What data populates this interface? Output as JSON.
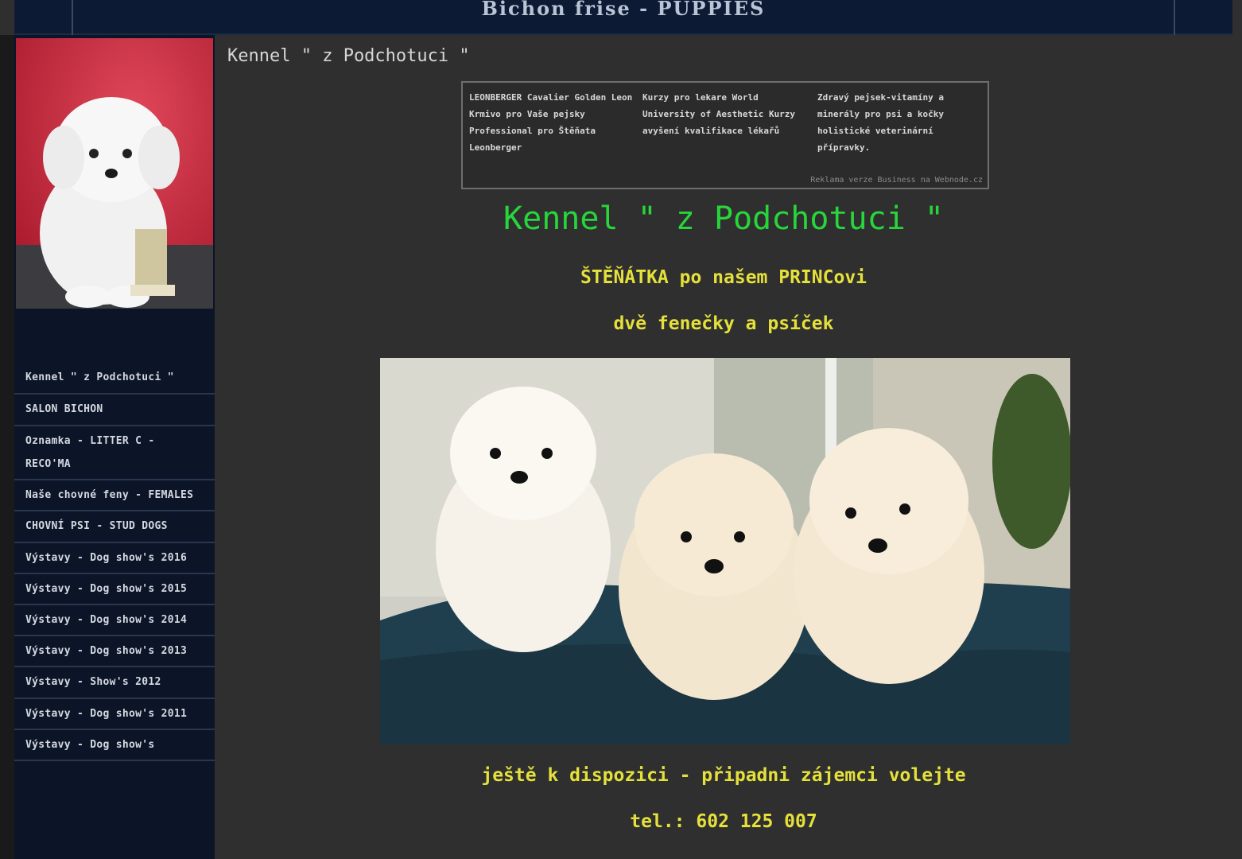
{
  "header": {
    "title": "Bichon frise - PUPPIES"
  },
  "sidebar": {
    "photo_icon": "bichon-puppy-photo",
    "items": [
      {
        "label": "Kennel \" z Podchotuci \""
      },
      {
        "label": "SALON BICHON"
      },
      {
        "label": "Oznamka - LITTER C - RECO'MA"
      },
      {
        "label": "Naše chovné feny - FEMALES"
      },
      {
        "label": "CHOVNÍ PSI - STUD DOGS"
      },
      {
        "label": "Výstavy - Dog show's 2016"
      },
      {
        "label": "Výstavy - Dog show's 2015"
      },
      {
        "label": "Výstavy - Dog show's 2014"
      },
      {
        "label": "Výstavy - Dog show's 2013"
      },
      {
        "label": "Výstavy - Show's 2012"
      },
      {
        "label": "Výstavy - Dog show's 2011"
      },
      {
        "label": "Výstavy - Dog show's"
      }
    ]
  },
  "main": {
    "breadcrumb": "Kennel \" z Podchotuci \"",
    "ad": {
      "col1": "LEONBERGER Cavalier Golden Leon Krmivo pro Vaše pejsky Professional pro Štěňata Leonberger",
      "col2": "Kurzy pro lekare World University of Aesthetic Kurzy avyšení kvalifikace lékařů",
      "col3": "Zdravý pejsek-vitamíny a minerály pro psi a kočky holistické veterinární přípravky.",
      "footer": "Reklama verze Business na Webnode.cz"
    },
    "title": "Kennel \" z Podchotuci \"",
    "subtitle1": "ŠTĚŇÁTKA po našem PRINCovi",
    "subtitle2": "dvě fenečky a psíček",
    "photo_icon": "three-puppies-photo",
    "available": "ještě k dispozici - připadni zájemci volejte",
    "phone": "tel.:  602 125 007"
  },
  "colors": {
    "title_green": "#27d63a",
    "text_yellow": "#e5e13a",
    "nav_bg": "#0c1528",
    "page_bg": "#2f2f2f"
  }
}
